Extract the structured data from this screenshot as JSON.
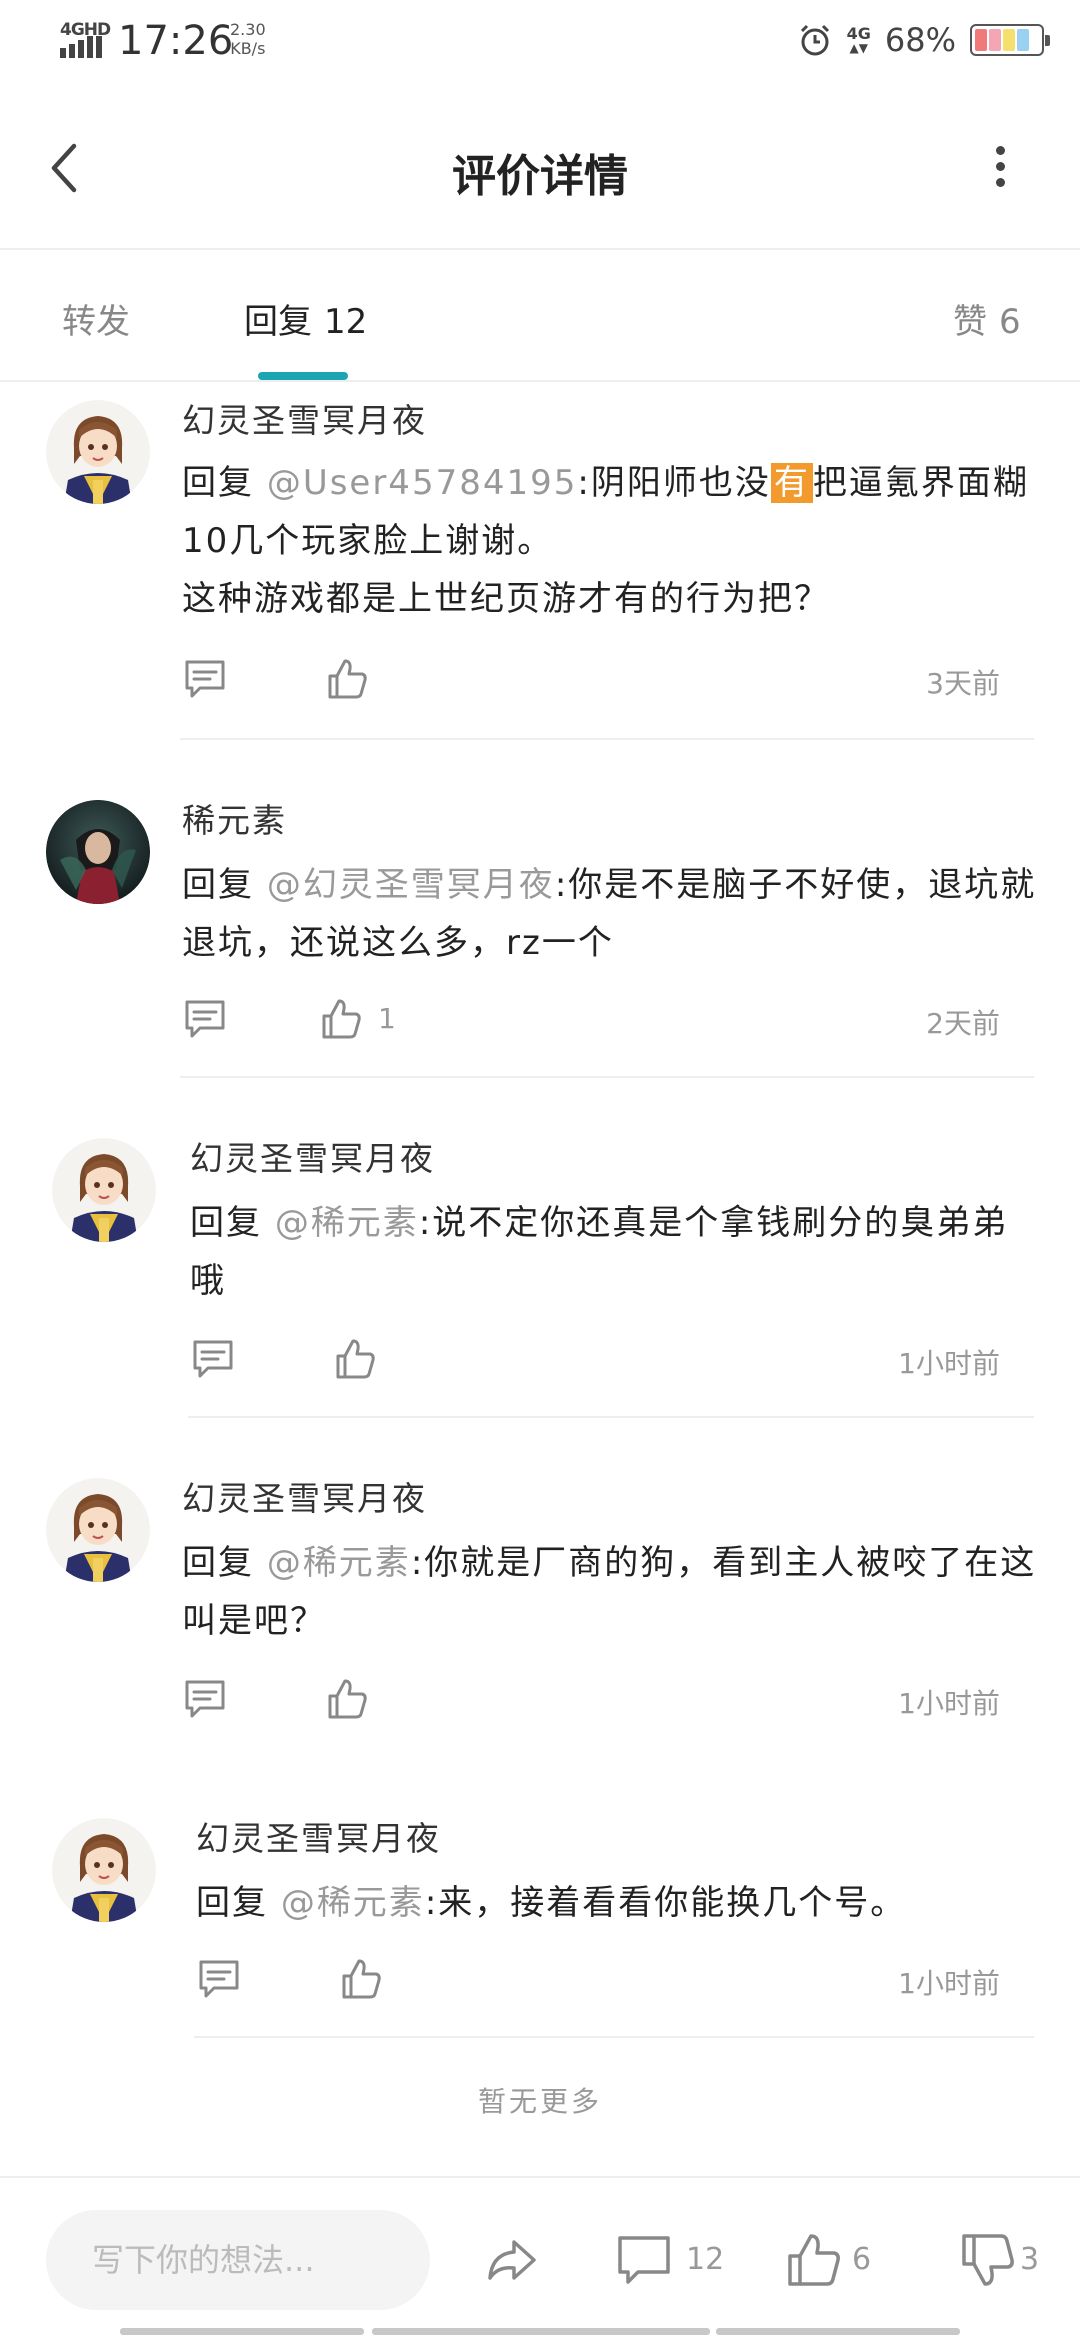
{
  "status_bar": {
    "network": "4GHD",
    "time": "17:26",
    "speed_value": "2.30",
    "speed_unit": "KB/s",
    "network_right": "4G",
    "battery": "68%",
    "icons": [
      "signal-icon",
      "alarm-icon",
      "battery-icon"
    ]
  },
  "header": {
    "title": "评价详情",
    "back_icon": "back-arrow-icon",
    "more_icon": "more-vertical-icon"
  },
  "tabs": [
    {
      "label": "转发",
      "count": ""
    },
    {
      "label": "回复",
      "count": "12"
    },
    {
      "label": "赞",
      "count": "6"
    }
  ],
  "active_tab": 1,
  "accent_color": "#1aa5b0",
  "comments": [
    {
      "user": "幻灵圣雪冥月夜",
      "reply_prefix": "回复 ",
      "mention": "@User45784195",
      "text_before_hl": ":阴阳师也没",
      "highlight": "有",
      "text_after_hl": "把逼氪界面糊10几个玩家脸上谢谢。",
      "text_line2": "这种游戏都是上世纪页游才有的行为把？",
      "likes": "",
      "time": "3天前"
    },
    {
      "user": "稀元素",
      "reply_prefix": "回复 ",
      "mention": "@幻灵圣雪冥月夜",
      "text": ":你是不是脑子不好使，退坑就退坑，还说这么多，rz一个",
      "likes": "1",
      "time": "2天前"
    },
    {
      "user": "幻灵圣雪冥月夜",
      "reply_prefix": "回复 ",
      "mention": "@稀元素",
      "text": ":说不定你还真是个拿钱刷分的臭弟弟哦",
      "likes": "",
      "time": "1小时前"
    },
    {
      "user": "幻灵圣雪冥月夜",
      "reply_prefix": "回复 ",
      "mention": "@稀元素",
      "text": ":你就是厂商的狗，看到主人被咬了在这叫是吧？",
      "likes": "",
      "time": "1小时前"
    },
    {
      "user": "幻灵圣雪冥月夜",
      "reply_prefix": "回复 ",
      "mention": "@稀元素",
      "text": ":来，接着看看你能换几个号。",
      "likes": "",
      "time": "1小时前"
    }
  ],
  "no_more": "暂无更多",
  "bottom_bar": {
    "input_placeholder": "写下你的想法...",
    "comment_count": "12",
    "like_count": "6",
    "dislike_count": "3"
  }
}
